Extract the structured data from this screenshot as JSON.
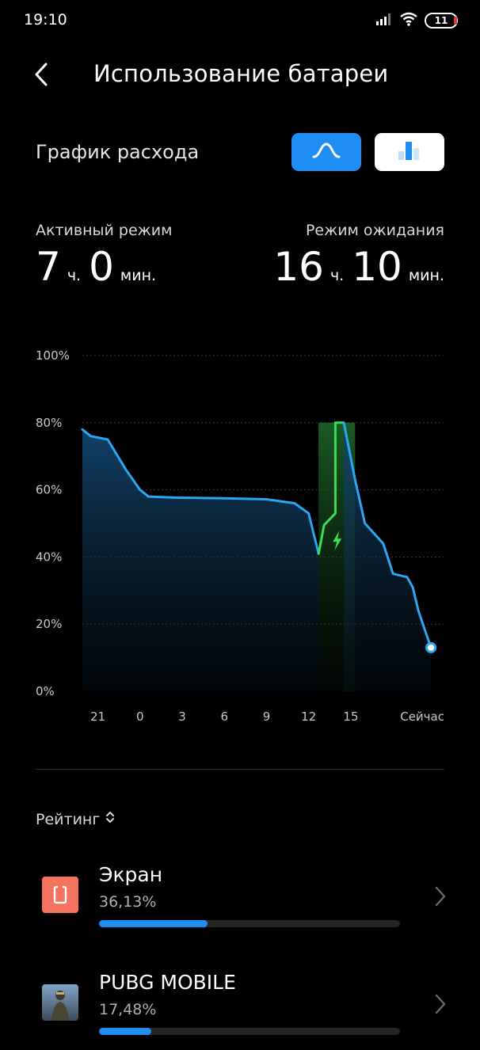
{
  "status_bar": {
    "time": "19:10",
    "battery_level": "11",
    "icons": [
      "signal-icon",
      "wifi-icon",
      "battery-icon"
    ]
  },
  "header": {
    "back_icon": "chevron-left-icon",
    "title": "Использование батареи"
  },
  "usage_section": {
    "title": "График расхода",
    "view_toggle": {
      "curve_icon": "line-chart-icon",
      "bars_icon": "bar-chart-icon",
      "selected": "curve",
      "accent": "#1E8EF5"
    }
  },
  "stats": {
    "active": {
      "label": "Активный режим",
      "hours": "7",
      "hours_unit": "ч.",
      "minutes": "0",
      "minutes_unit": "мин."
    },
    "standby": {
      "label": "Режим ожидания",
      "hours": "16",
      "hours_unit": "ч.",
      "minutes": "10",
      "minutes_unit": "мин."
    }
  },
  "chart_data": {
    "type": "area",
    "title": "",
    "xlabel": "",
    "ylabel": "",
    "y_ticks": [
      "100%",
      "80%",
      "60%",
      "40%",
      "20%",
      "0%"
    ],
    "ylim": [
      0,
      100
    ],
    "x_ticks": [
      "21",
      "0",
      "3",
      "6",
      "9",
      "12",
      "15",
      "Сейчас"
    ],
    "x_tick_hours": [
      21,
      24,
      27,
      30,
      33,
      36,
      39,
      43
    ],
    "xlim": [
      19.9,
      45.2
    ],
    "grid": true,
    "discharge_color": "#2AA7F0",
    "charge_color": "#3DDC57",
    "series": [
      {
        "type": "discharge",
        "x": [
          19.9,
          20.5,
          21.7,
          23.0,
          24.0,
          24.6,
          26.5,
          30.0,
          33.0,
          35.0,
          36.0,
          36.7
        ],
        "y": [
          78,
          76,
          75,
          66,
          60,
          58,
          57.7,
          57.5,
          57.2,
          56,
          53,
          41
        ]
      },
      {
        "type": "charging",
        "x": [
          36.7,
          37.1,
          37.9,
          37.9,
          38.5
        ],
        "y": [
          41,
          49.5,
          53,
          80,
          80
        ]
      },
      {
        "type": "discharge",
        "x": [
          38.5,
          39.3,
          40.0,
          41.3,
          42.0,
          43.0,
          43.4,
          43.8,
          44.2,
          44.7
        ],
        "y": [
          80,
          63,
          50,
          44,
          35,
          34,
          31,
          24,
          19,
          13
        ]
      }
    ],
    "current_point": {
      "x": 44.7,
      "y": 13
    },
    "charging_window": [
      36.7,
      39.3
    ]
  },
  "rating": {
    "label": "Рейтинг",
    "sort_icon": "sort-updown-icon"
  },
  "app_list": [
    {
      "name": "Экран",
      "percent_text": "36,13%",
      "percent": 36.13,
      "icon": "screen-icon",
      "icon_color": "#F4735E"
    },
    {
      "name": "PUBG MOBILE",
      "percent_text": "17,48%",
      "percent": 17.48,
      "icon": "pubg-app-icon",
      "icon_color": "#5F7A94"
    }
  ]
}
